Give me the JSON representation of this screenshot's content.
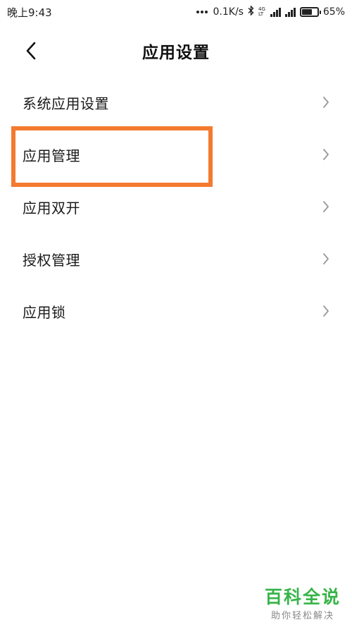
{
  "status_bar": {
    "time": "晚上9:43",
    "net_speed": "0.1K/s",
    "network_type_top": "4G",
    "network_type_bottom": "LT",
    "battery_percent_text": "65%",
    "battery_level": 0.65
  },
  "header": {
    "title": "应用设置",
    "back_icon": "chevron-left-icon"
  },
  "settings": {
    "items": [
      {
        "label": "系统应用设置"
      },
      {
        "label": "应用管理"
      },
      {
        "label": "应用双开"
      },
      {
        "label": "授权管理"
      },
      {
        "label": "应用锁"
      }
    ]
  },
  "highlight": {
    "color": "#f47a2f"
  },
  "watermark": {
    "title": "百科全说",
    "subtitle": "助你轻松解决",
    "color": "#38b449"
  }
}
